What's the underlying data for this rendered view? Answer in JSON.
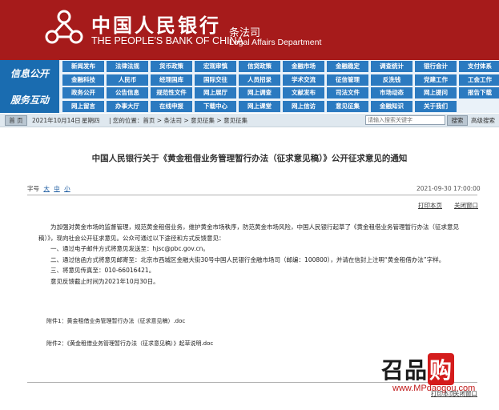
{
  "header": {
    "brand_cn": "中国人民银行",
    "brand_en": "THE PEOPLE'S BANK OF CHINA",
    "dept_cn": "条法司",
    "dept_en": "Legal Affairs Department",
    "bg_color": "#a61b1b"
  },
  "nav": {
    "label_1": "信息公开",
    "label_2": "服务互动",
    "rows": [
      [
        "新闻发布",
        "法律法规",
        "货币政策",
        "宏观审慎",
        "信贷政策",
        "金融市场",
        "金融稳定",
        "调查统计",
        "银行会计",
        "支付体系"
      ],
      [
        "金融科技",
        "人民币",
        "经理国库",
        "国际交往",
        "人员招录",
        "学术交流",
        "征信管理",
        "反洗钱",
        "党建工作",
        "工会工作"
      ],
      [
        "政务公开",
        "公告信息",
        "规范性文件",
        "网上展厅",
        "网上调查",
        "文献发布",
        "司法文件",
        "市场动态",
        "网上提问",
        "报告下载"
      ],
      [
        "网上留言",
        "办事大厅",
        "在线申报",
        "下载中心",
        "网上课堂",
        "网上信访",
        "意见征集",
        "金融知识",
        "关于我们"
      ]
    ],
    "accent_color": "#2b7ac0"
  },
  "crumb_bar": {
    "home_label": "首 页",
    "date": "2021年10月14日",
    "weekday": "星期四",
    "path": "| 您的位置：首页 > 条法司 > 意见征集 > 意见征集",
    "search_placeholder": "请输入搜索关键字",
    "search_button": "搜索",
    "advanced_search": "高级搜索"
  },
  "article": {
    "title": "中国人民银行关于《黄金租借业务管理暂行办法（征求意见稿）》公开征求意见的通知",
    "font_size_label": "字号",
    "font_large": "大",
    "font_medium": "中",
    "font_small": "小",
    "date": "2021-09-30 17:00:00",
    "print": "打印本页",
    "close": "关闭窗口",
    "para1": "为加强对黄金市场的监督管理，规范黄金租借业务，维护黄金市场秩序，防范黄金市场风险，中国人民银行起草了《黄金租借业务管理暂行办法（征求意见稿）》，现向社会公开征求意见。公众可通过以下途径和方式反馈意见：",
    "para2": "一、通过电子邮件方式将意见发送至：hjsc@pbc.gov.cn。",
    "para3": "二、通过信函方式将意见邮寄至：北京市西城区金融大街30号中国人民银行金融市场司（邮编：100800），并请在信封上注明“黄金租借办法”字样。",
    "para4": "三、将意见传真至：010-66016421。",
    "para5": "意见反馈截止时间为2021年10月30日。",
    "attachment_1": "附件1：黄金租借业务管理暂行办法（征求意见稿）.doc",
    "attachment_2": "附件2：《黄金租借业务管理暂行办法（征求意见稿）》起草说明.doc",
    "print_bottom": "打印本页",
    "close_bottom": "关闭窗口"
  },
  "watermark": {
    "text_a": "召品",
    "text_b": "购",
    "url": "www.MPdaogou.com"
  }
}
